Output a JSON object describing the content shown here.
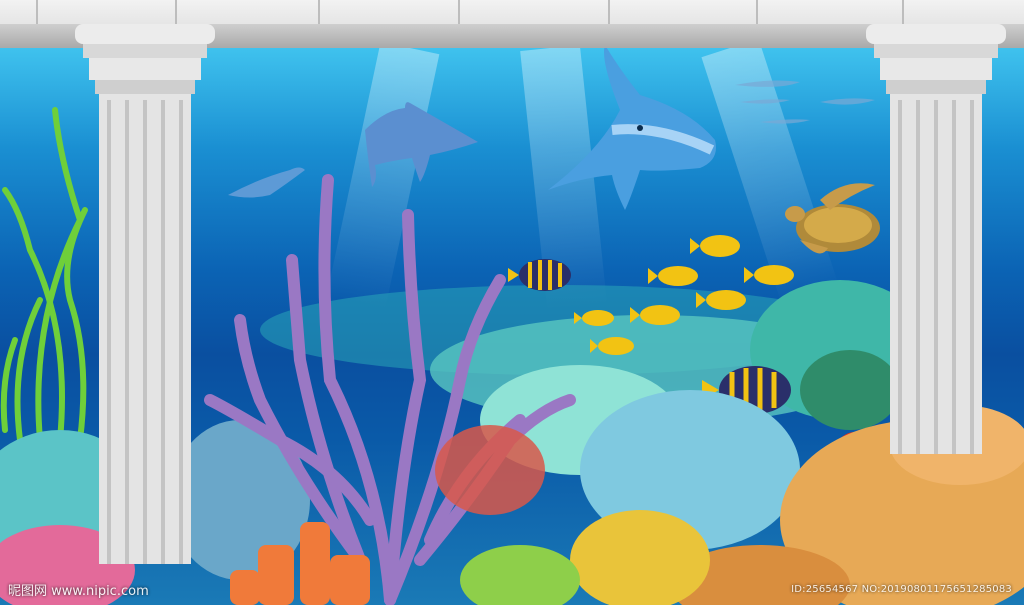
{
  "scene": {
    "description_palette": {
      "water_top": "#3fc2ee",
      "water_deep": "#0a4fa0",
      "pillar": "#e6e6e6",
      "coral_purple": "#9a78c4",
      "coral_orange": "#e39a4a",
      "coral_teal": "#6fd3c8",
      "fish_yellow": "#f2c313"
    }
  },
  "watermark": {
    "text": "昵图网 www.nipic.com"
  },
  "image_id": {
    "text": "ID:25654567 NO:20190801175651285083"
  }
}
